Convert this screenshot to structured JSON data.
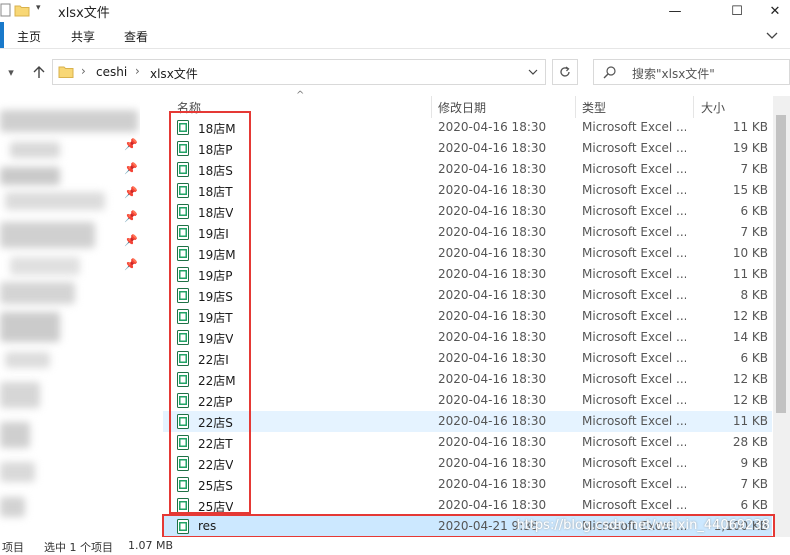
{
  "window": {
    "title": "xlsx文件",
    "controls": {
      "minimize": "—",
      "maximize": "☐",
      "close": "✕"
    }
  },
  "ribbon": {
    "tabs": [
      "主页",
      "共享",
      "查看"
    ],
    "expand_icon": "chevron-down"
  },
  "address": {
    "path": [
      "ceshi",
      "xlsx文件"
    ],
    "search_placeholder": "搜索\"xlsx文件\""
  },
  "columns": {
    "name": "名称",
    "date": "修改日期",
    "type": "类型",
    "size": "大小"
  },
  "files": [
    {
      "name": "18店M",
      "date": "2020-04-16 18:30",
      "type": "Microsoft Excel ...",
      "size": "11 KB"
    },
    {
      "name": "18店P",
      "date": "2020-04-16 18:30",
      "type": "Microsoft Excel ...",
      "size": "19 KB"
    },
    {
      "name": "18店S",
      "date": "2020-04-16 18:30",
      "type": "Microsoft Excel ...",
      "size": "7 KB"
    },
    {
      "name": "18店T",
      "date": "2020-04-16 18:30",
      "type": "Microsoft Excel ...",
      "size": "15 KB"
    },
    {
      "name": "18店V",
      "date": "2020-04-16 18:30",
      "type": "Microsoft Excel ...",
      "size": "6 KB"
    },
    {
      "name": "19店I",
      "date": "2020-04-16 18:30",
      "type": "Microsoft Excel ...",
      "size": "7 KB"
    },
    {
      "name": "19店M",
      "date": "2020-04-16 18:30",
      "type": "Microsoft Excel ...",
      "size": "10 KB"
    },
    {
      "name": "19店P",
      "date": "2020-04-16 18:30",
      "type": "Microsoft Excel ...",
      "size": "11 KB"
    },
    {
      "name": "19店S",
      "date": "2020-04-16 18:30",
      "type": "Microsoft Excel ...",
      "size": "8 KB"
    },
    {
      "name": "19店T",
      "date": "2020-04-16 18:30",
      "type": "Microsoft Excel ...",
      "size": "12 KB"
    },
    {
      "name": "19店V",
      "date": "2020-04-16 18:30",
      "type": "Microsoft Excel ...",
      "size": "14 KB"
    },
    {
      "name": "22店I",
      "date": "2020-04-16 18:30",
      "type": "Microsoft Excel ...",
      "size": "6 KB"
    },
    {
      "name": "22店M",
      "date": "2020-04-16 18:30",
      "type": "Microsoft Excel ...",
      "size": "12 KB"
    },
    {
      "name": "22店P",
      "date": "2020-04-16 18:30",
      "type": "Microsoft Excel ...",
      "size": "12 KB"
    },
    {
      "name": "22店S",
      "date": "2020-04-16 18:30",
      "type": "Microsoft Excel ...",
      "size": "11 KB"
    },
    {
      "name": "22店T",
      "date": "2020-04-16 18:30",
      "type": "Microsoft Excel ...",
      "size": "28 KB"
    },
    {
      "name": "22店V",
      "date": "2020-04-16 18:30",
      "type": "Microsoft Excel ...",
      "size": "9 KB"
    },
    {
      "name": "25店S",
      "date": "2020-04-16 18:30",
      "type": "Microsoft Excel ...",
      "size": "7 KB"
    },
    {
      "name": "25店V",
      "date": "2020-04-16 18:30",
      "type": "Microsoft Excel ...",
      "size": "6 KB"
    },
    {
      "name": "res",
      "date": "2020-04-21 9:38",
      "type": "Microsoft Excel ...",
      "size": "1,100 KB"
    }
  ],
  "hovered_index": 14,
  "selected_index": 19,
  "status": {
    "items": "项目",
    "selected": "选中 1 个项目",
    "size": "1.07 MB"
  },
  "watermark": "https://blog.csdn.net/weixin_44069238",
  "colors": {
    "selection": "#cce8ff",
    "hover": "#e5f3ff",
    "annotation_red": "#e53935",
    "excel_green": "#1e7145",
    "folder_yellow": "#f8d775"
  }
}
